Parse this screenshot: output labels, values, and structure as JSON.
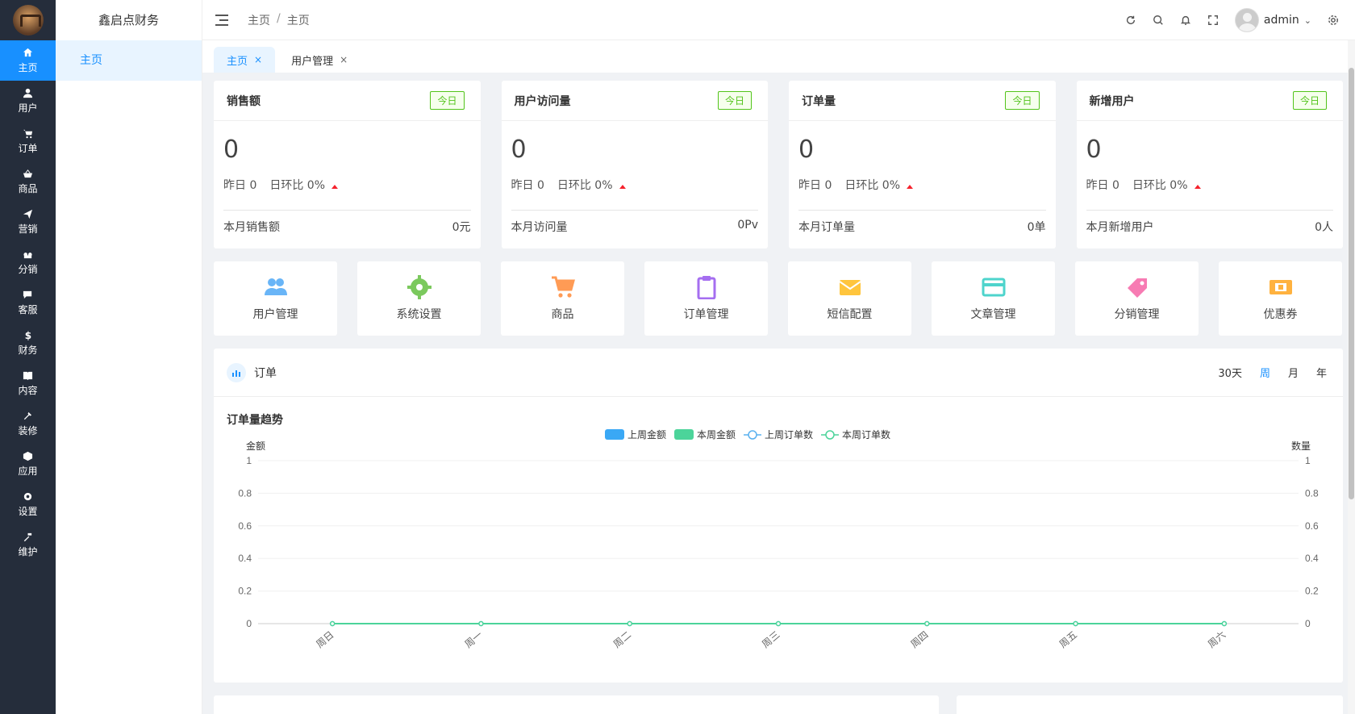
{
  "sidebar": {
    "items": [
      {
        "label": "主页",
        "icon": "home-icon"
      },
      {
        "label": "用户",
        "icon": "user-icon"
      },
      {
        "label": "订单",
        "icon": "cart-icon"
      },
      {
        "label": "商品",
        "icon": "basket-icon"
      },
      {
        "label": "营销",
        "icon": "send-icon"
      },
      {
        "label": "分销",
        "icon": "share-icon"
      },
      {
        "label": "客服",
        "icon": "chat-icon"
      },
      {
        "label": "财务",
        "icon": "dollar-icon"
      },
      {
        "label": "内容",
        "icon": "book-icon"
      },
      {
        "label": "装修",
        "icon": "tools-icon"
      },
      {
        "label": "应用",
        "icon": "cube-icon"
      },
      {
        "label": "设置",
        "icon": "gear-icon"
      },
      {
        "label": "维护",
        "icon": "hammer-icon"
      }
    ]
  },
  "subside": {
    "title": "鑫启点财务",
    "item": "主页"
  },
  "header": {
    "breadcrumb": [
      "主页",
      "主页"
    ],
    "separator": "/",
    "username": "admin"
  },
  "tabs": [
    {
      "label": "主页",
      "close": "×"
    },
    {
      "label": "用户管理",
      "close": "×"
    }
  ],
  "stats": [
    {
      "title": "销售额",
      "badge": "今日",
      "value": "0",
      "yesterday": "昨日 0",
      "ratio": "日环比 0%",
      "footer_label": "本月销售额",
      "footer_value": "0元"
    },
    {
      "title": "用户访问量",
      "badge": "今日",
      "value": "0",
      "yesterday": "昨日 0",
      "ratio": "日环比 0%",
      "footer_label": "本月访问量",
      "footer_value": "0Pv"
    },
    {
      "title": "订单量",
      "badge": "今日",
      "value": "0",
      "yesterday": "昨日 0",
      "ratio": "日环比 0%",
      "footer_label": "本月订单量",
      "footer_value": "0单"
    },
    {
      "title": "新增用户",
      "badge": "今日",
      "value": "0",
      "yesterday": "昨日 0",
      "ratio": "日环比 0%",
      "footer_label": "本月新增用户",
      "footer_value": "0人"
    }
  ],
  "quick": [
    {
      "label": "用户管理",
      "icon": "users-icon",
      "color": "#69b5f7"
    },
    {
      "label": "系统设置",
      "icon": "gear-icon",
      "color": "#7bc95d"
    },
    {
      "label": "商品",
      "icon": "cart-icon",
      "color": "#ff9b55"
    },
    {
      "label": "订单管理",
      "icon": "clipboard-icon",
      "color": "#a56ef0"
    },
    {
      "label": "短信配置",
      "icon": "mail-icon",
      "color": "#ffc53d"
    },
    {
      "label": "文章管理",
      "icon": "card-icon",
      "color": "#4ed4cc"
    },
    {
      "label": "分销管理",
      "icon": "tag-icon",
      "color": "#f77bb3"
    },
    {
      "label": "优惠券",
      "icon": "coupon-icon",
      "color": "#ffb23f"
    }
  ],
  "order_panel": {
    "title": "订单",
    "ranges": [
      "30天",
      "周",
      "月",
      "年"
    ],
    "active_range": "周",
    "chart_title": "订单量趋势"
  },
  "chart_data": {
    "type": "line",
    "title": "订单量趋势",
    "categories": [
      "周日",
      "周一",
      "周二",
      "周三",
      "周四",
      "周五",
      "周六"
    ],
    "ylabel_left": "金额",
    "ylabel_right": "数量",
    "ylim": [
      0,
      1
    ],
    "yticks": [
      "0",
      "0.2",
      "0.4",
      "0.6",
      "0.8",
      "1"
    ],
    "legend_position": "top-center",
    "series": [
      {
        "name": "上周金额",
        "kind": "bar",
        "color": "#3aa8f5",
        "values": [
          0,
          0,
          0,
          0,
          0,
          0,
          0
        ]
      },
      {
        "name": "本周金额",
        "kind": "bar",
        "color": "#4cd49a",
        "values": [
          0,
          0,
          0,
          0,
          0,
          0,
          0
        ]
      },
      {
        "name": "上周订单数",
        "kind": "line",
        "color": "#5ab1ef",
        "values": [
          0,
          0,
          0,
          0,
          0,
          0,
          0
        ]
      },
      {
        "name": "本周订单数",
        "kind": "line",
        "color": "#4cd49a",
        "values": [
          0,
          0,
          0,
          0,
          0,
          0,
          0
        ]
      }
    ]
  }
}
